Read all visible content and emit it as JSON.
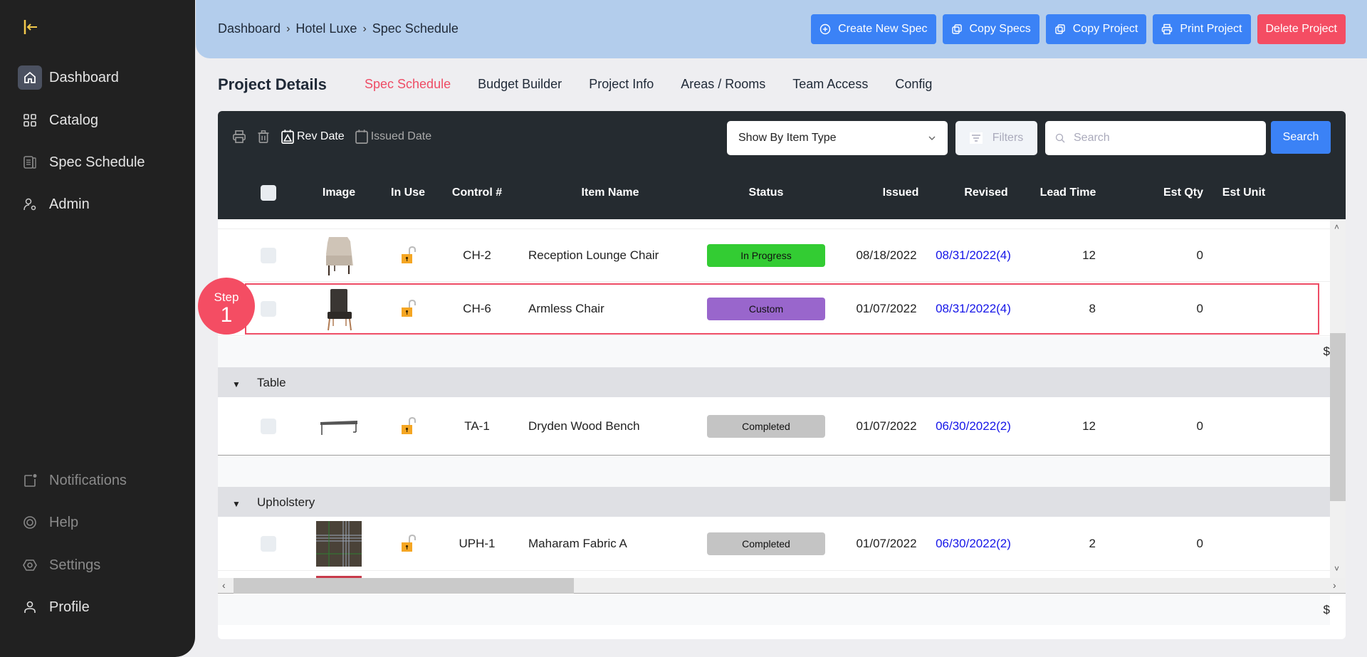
{
  "sidebar": {
    "logo_icon": "collapse-sidebar-icon",
    "items": [
      {
        "label": "Dashboard",
        "icon": "home-icon",
        "active": true
      },
      {
        "label": "Catalog",
        "icon": "grid-icon"
      },
      {
        "label": "Spec Schedule",
        "icon": "document-icon"
      },
      {
        "label": "Admin",
        "icon": "user-gear-icon"
      }
    ],
    "bottom_items": [
      {
        "label": "Notifications",
        "icon": "notification-icon"
      },
      {
        "label": "Help",
        "icon": "lifebuoy-icon"
      },
      {
        "label": "Settings",
        "icon": "settings-icon"
      },
      {
        "label": "Profile",
        "icon": "user-icon"
      }
    ]
  },
  "header": {
    "breadcrumb": [
      "Dashboard",
      "Hotel Luxe",
      "Spec Schedule"
    ],
    "buttons": [
      {
        "label": "Create New Spec",
        "icon": "plus-circle-icon"
      },
      {
        "label": "Copy Specs",
        "icon": "copy-icon"
      },
      {
        "label": "Copy Project",
        "icon": "copy-icon"
      },
      {
        "label": "Print Project",
        "icon": "printer-icon"
      },
      {
        "label": "Delete Project"
      }
    ]
  },
  "page": {
    "title": "Project Details",
    "tabs": [
      "Spec Schedule",
      "Budget Builder",
      "Project Info",
      "Areas / Rooms",
      "Team Access",
      "Config"
    ],
    "active_tab": "Spec Schedule"
  },
  "toolbar": {
    "rev_date": "Rev Date",
    "issued_date": "Issued Date",
    "show_by": "Show By Item Type",
    "filters": "Filters",
    "search_placeholder": "Search",
    "search_button": "Search"
  },
  "columns": [
    "Image",
    "In Use",
    "Control #",
    "Item Name",
    "Status",
    "Issued",
    "Revised",
    "Lead Time",
    "Est Qty",
    "Est Unit"
  ],
  "rows": [
    {
      "control": "CH-2",
      "name": "Reception Lounge Chair",
      "status": "In Progress",
      "status_color": "#33cc33",
      "issued": "08/18/2022",
      "revised": "08/31/2022(4)",
      "lead_time": "12",
      "est_qty": "0",
      "image": "lounge-chair"
    },
    {
      "control": "CH-6",
      "name": "Armless Chair",
      "status": "Custom",
      "status_color": "#9966cc",
      "issued": "01/07/2022",
      "revised": "08/31/2022(4)",
      "lead_time": "8",
      "est_qty": "0",
      "image": "armless-chair"
    }
  ],
  "subtotal_symbol": "$",
  "groups": [
    {
      "name": "Table",
      "rows": [
        {
          "control": "TA-1",
          "name": "Dryden Wood Bench",
          "status": "Completed",
          "status_color": "#c4c4c4",
          "issued": "01/07/2022",
          "revised": "06/30/2022(2)",
          "lead_time": "12",
          "est_qty": "0",
          "image": "bench"
        }
      ]
    },
    {
      "name": "Upholstery",
      "rows": [
        {
          "control": "UPH-1",
          "name": "Maharam Fabric A",
          "status": "Completed",
          "status_color": "#c4c4c4",
          "issued": "01/07/2022",
          "revised": "06/30/2022(2)",
          "lead_time": "2",
          "est_qty": "0",
          "image": "plaid-fabric"
        }
      ]
    }
  ],
  "partial_row_status_color": "#5bc8f5",
  "footer_symbol": "$",
  "annotation": {
    "step_label": "Step",
    "step_number": "1"
  }
}
